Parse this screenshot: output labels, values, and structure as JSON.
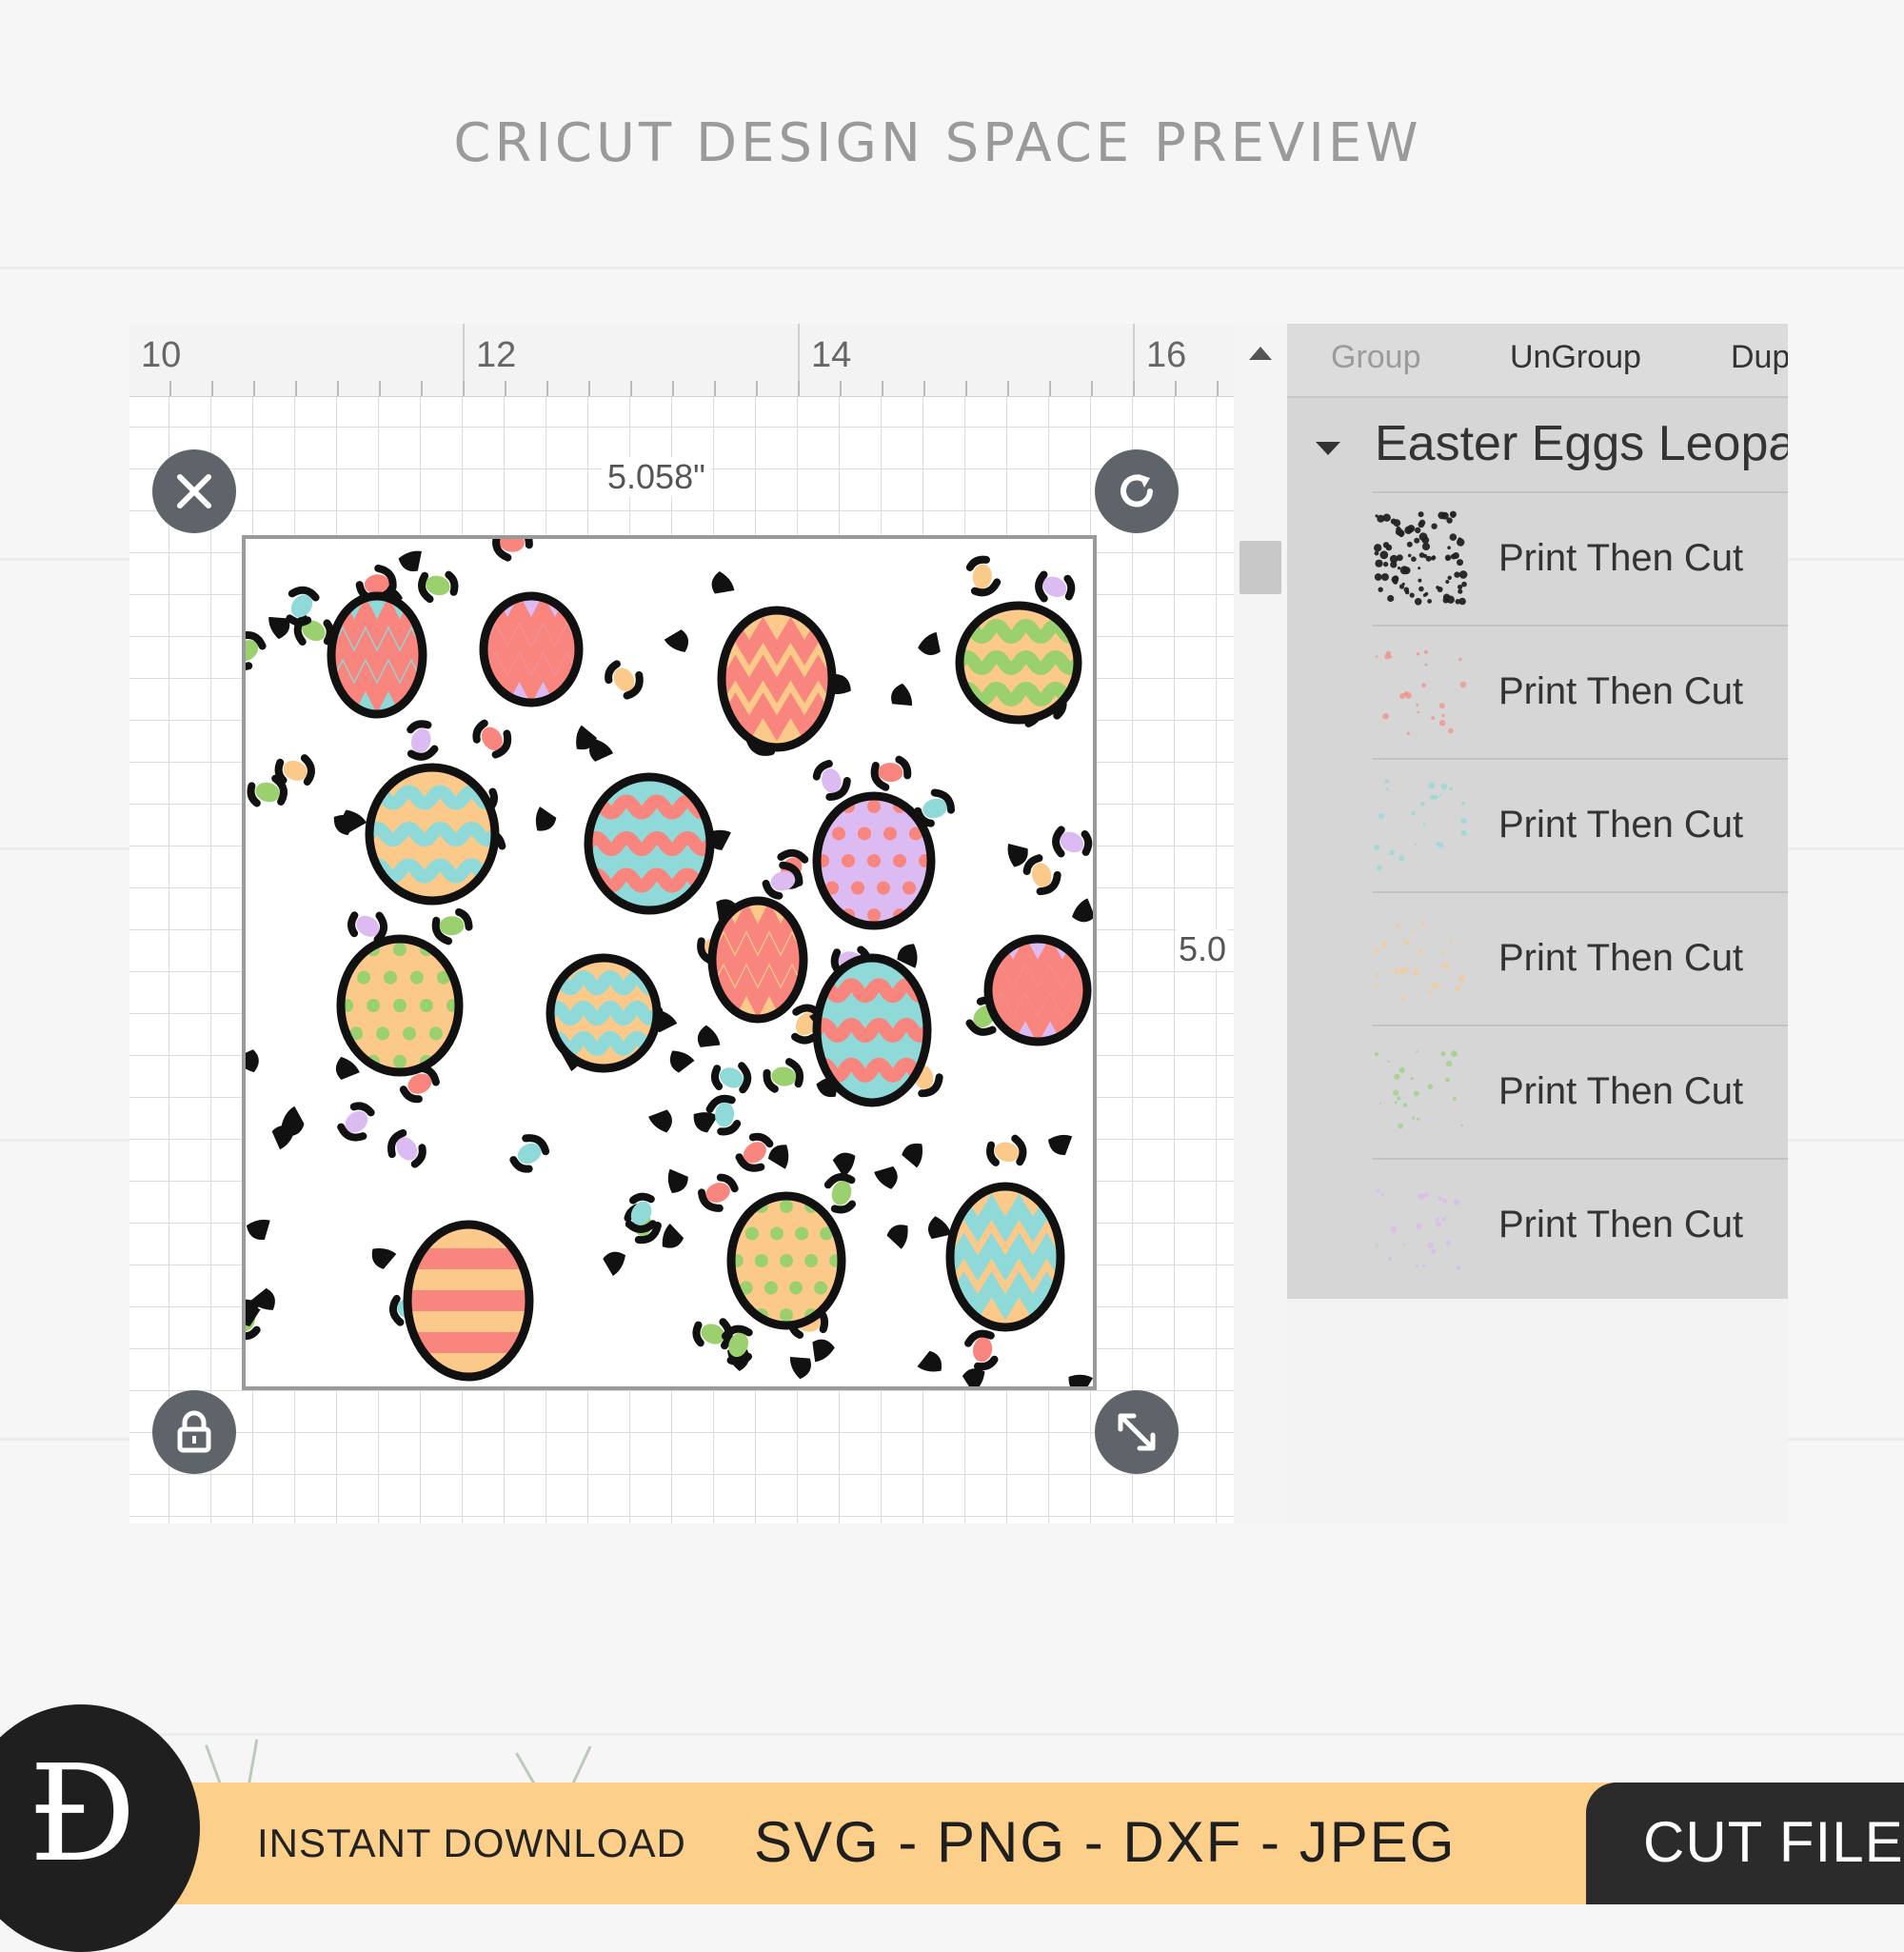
{
  "header": {
    "title": "CRICUT DESIGN SPACE PREVIEW"
  },
  "canvas": {
    "ruler_labels": [
      "10",
      "12",
      "14",
      "16"
    ],
    "width_label": "5.058\"",
    "height_label": "5.0"
  },
  "toolbar": {
    "group_label": "Group",
    "ungroup_label": "UnGroup",
    "duplicate_label": "Dup"
  },
  "layers": {
    "group_title": "Easter Eggs Leopa",
    "items": [
      {
        "label": "Print Then Cut",
        "thumb_color": "#222222"
      },
      {
        "label": "Print Then Cut",
        "thumb_color": "#f28b82"
      },
      {
        "label": "Print Then Cut",
        "thumb_color": "#8fd8d8"
      },
      {
        "label": "Print Then Cut",
        "thumb_color": "#f9c98a"
      },
      {
        "label": "Print Then Cut",
        "thumb_color": "#98d07a"
      },
      {
        "label": "Print Then Cut",
        "thumb_color": "#d8b8f0"
      }
    ]
  },
  "footer": {
    "instant_label": "INSTANT DOWNLOAD",
    "formats_label": "SVG - PNG - DXF - JPEG",
    "badge_label": "CUT FILE",
    "logo_glyph": "Ð"
  },
  "colors": {
    "egg_pink": "#f9857f",
    "egg_teal": "#8fdad8",
    "egg_orange": "#fbc98a",
    "egg_green": "#9bd06e",
    "egg_lilac": "#dcbaf2",
    "footer_band": "#fcd08a",
    "handle": "#5e6469"
  }
}
